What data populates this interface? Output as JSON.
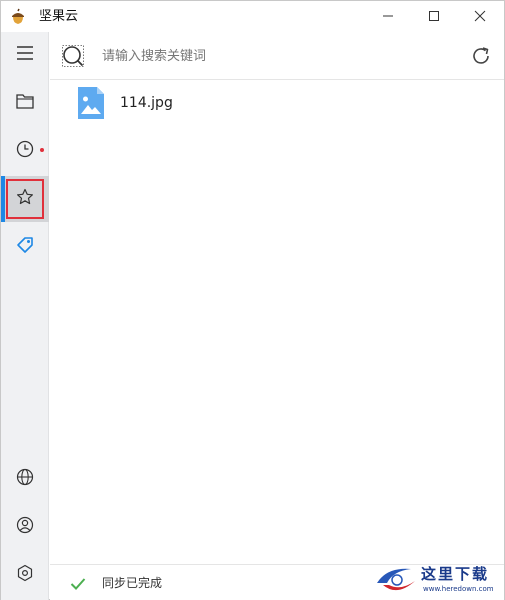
{
  "window": {
    "title": "坚果云",
    "logo_icon": "acorn-icon",
    "controls": [
      "minimize-icon",
      "maximize-icon",
      "close-icon"
    ]
  },
  "sidebar": {
    "items": [
      {
        "name": "menu",
        "icon": "hamburger-menu-icon"
      },
      {
        "name": "files",
        "icon": "folder-icon"
      },
      {
        "name": "recent",
        "icon": "clock-icon",
        "has_notification_dot": true
      },
      {
        "name": "favorites",
        "icon": "star-icon",
        "active": true
      },
      {
        "name": "tags",
        "icon": "tag-icon"
      }
    ],
    "bottom_items": [
      {
        "name": "globe",
        "icon": "globe-icon"
      },
      {
        "name": "account",
        "icon": "user-icon"
      },
      {
        "name": "settings",
        "icon": "settings-icon"
      }
    ],
    "accent_color": "#1e88e5",
    "highlight_color": "#e0303b"
  },
  "search": {
    "placeholder": "请输入搜索关键词",
    "value": ""
  },
  "files": [
    {
      "name": "114.jpg",
      "icon": "image-file-icon"
    }
  ],
  "status": {
    "text": "同步已完成",
    "icon": "check-icon",
    "color": "#4caf50"
  },
  "watermark": {
    "text": "这里下载",
    "url": "www.heredown.com"
  }
}
